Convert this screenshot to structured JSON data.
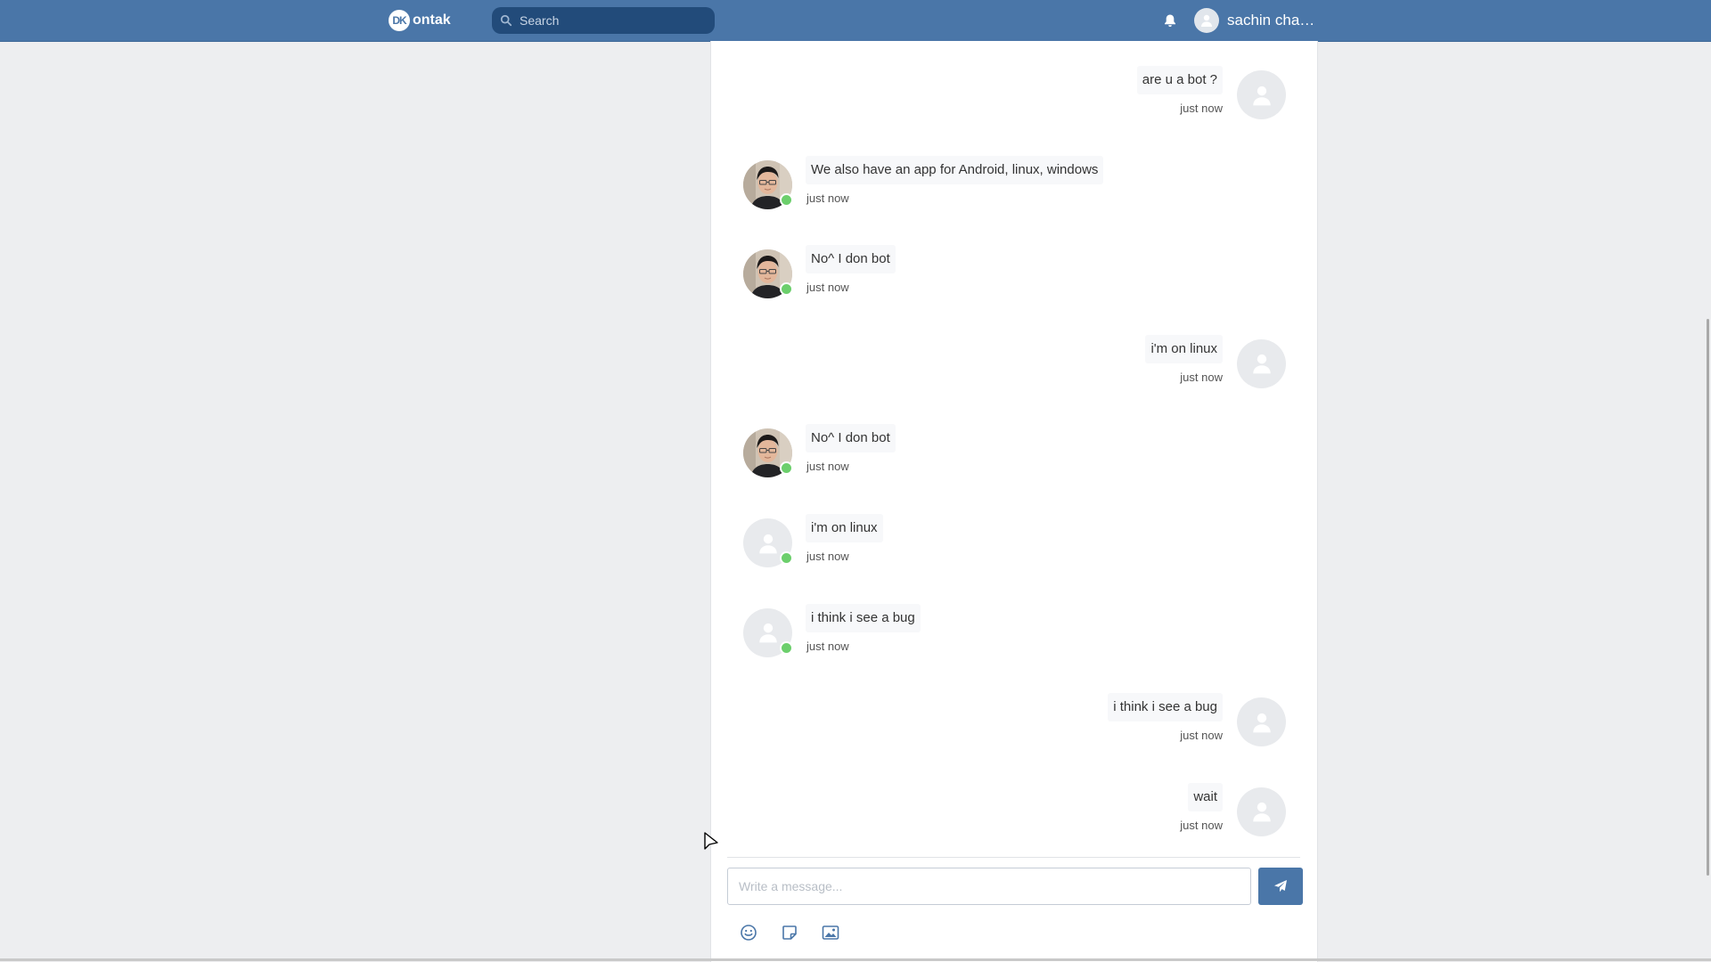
{
  "topbar": {
    "logo_mark": "DK",
    "logo_text": "ontak",
    "search_placeholder": "Search",
    "user_name": "sachin cha…"
  },
  "messages": [
    {
      "side": "right",
      "avatar": "default",
      "text": "are u a bot ?",
      "time": "just now"
    },
    {
      "side": "left",
      "avatar": "photo",
      "online": true,
      "text": "We also have an app for Android, linux, windows",
      "time": "just now"
    },
    {
      "side": "left",
      "avatar": "photo",
      "online": true,
      "text": "No^ I don bot",
      "time": "just now"
    },
    {
      "side": "right",
      "avatar": "default",
      "text": "i'm on linux",
      "time": "just now"
    },
    {
      "side": "left",
      "avatar": "photo",
      "online": true,
      "text": "No^ I don bot",
      "time": "just now"
    },
    {
      "side": "left",
      "avatar": "default",
      "online": true,
      "text": "i'm on linux",
      "time": "just now"
    },
    {
      "side": "left",
      "avatar": "default",
      "online": true,
      "text": "i think i see a bug",
      "time": "just now"
    },
    {
      "side": "right",
      "avatar": "default",
      "text": "i think i see a bug",
      "time": "just now"
    },
    {
      "side": "right",
      "avatar": "default",
      "text": "wait",
      "time": "just now"
    }
  ],
  "composer": {
    "placeholder": "Write a message..."
  },
  "colors": {
    "brand": "#4a76a8",
    "online": "#6ccf6c"
  },
  "icons": [
    "search-icon",
    "bell-icon",
    "user-icon",
    "send-icon",
    "emoji-icon",
    "sticker-icon",
    "image-icon"
  ]
}
